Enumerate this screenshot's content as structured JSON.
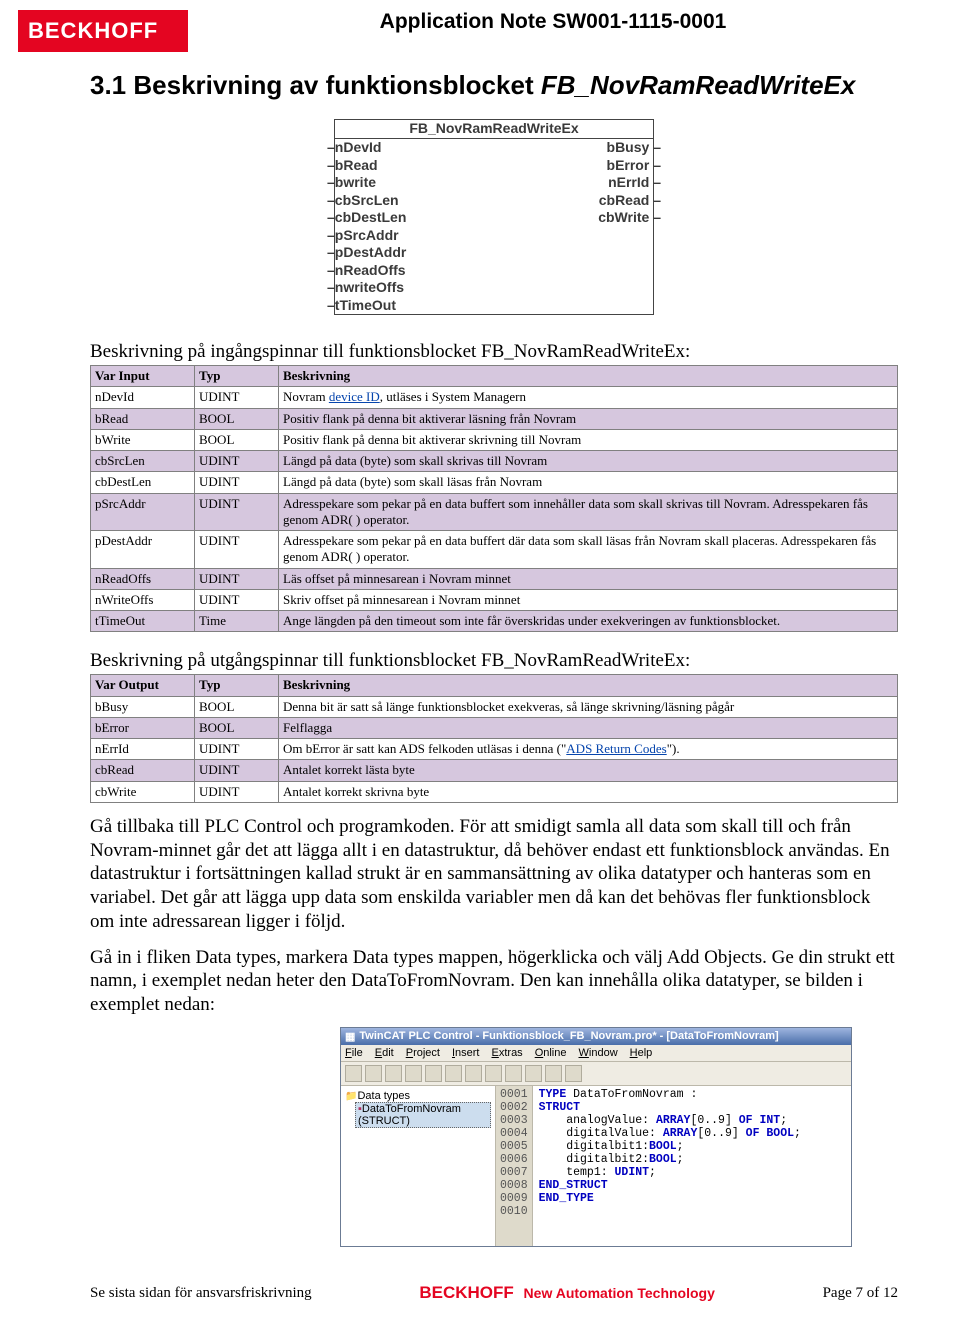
{
  "doc_header": {
    "logo_text": "BECKHOFF",
    "title": "Application Note SW001-1115-0001"
  },
  "section": {
    "number": "3.1",
    "title_lead": "Beskrivning av funktionsblocket",
    "fb_name": "FB_NovRamReadWriteEx"
  },
  "fb_diagram": {
    "title": "FB_NovRamReadWriteEx",
    "rows": [
      {
        "l": "nDevId",
        "r": "bBusy"
      },
      {
        "l": "bRead",
        "r": "bError"
      },
      {
        "l": "bwrite",
        "r": "nErrId"
      },
      {
        "l": "cbSrcLen",
        "r": "cbRead"
      },
      {
        "l": "cbDestLen",
        "r": "cbWrite"
      },
      {
        "l": "pSrcAddr",
        "r": ""
      },
      {
        "l": "pDestAddr",
        "r": ""
      },
      {
        "l": "nReadOffs",
        "r": ""
      },
      {
        "l": "nwriteOffs",
        "r": ""
      },
      {
        "l": "tTimeOut",
        "r": ""
      }
    ]
  },
  "input_caption": "Beskrivning på ingångspinnar till funktionsblocket FB_NovRamReadWriteEx:",
  "input_table": {
    "headers": [
      "Var Input",
      "Typ",
      "Beskrivning"
    ],
    "rows": [
      {
        "c0": "nDevId",
        "c1": "UDINT",
        "c2_pre": "Novram ",
        "c2_link": "device ID",
        "c2_post": ", utläses i System Managern"
      },
      {
        "c0": "bRead",
        "c1": "BOOL",
        "c2": "Positiv flank på denna bit aktiverar läsning från Novram"
      },
      {
        "c0": "bWrite",
        "c1": "BOOL",
        "c2": "Positiv flank på denna bit aktiverar skrivning till Novram"
      },
      {
        "c0": "cbSrcLen",
        "c1": "UDINT",
        "c2": "Längd på data (byte) som skall skrivas till Novram"
      },
      {
        "c0": "cbDestLen",
        "c1": "UDINT",
        "c2": "Längd på data (byte) som skall läsas från Novram"
      },
      {
        "c0": "pSrcAddr",
        "c1": "UDINT",
        "c2": "Adresspekare som pekar på en data buffert som innehåller data som skall skrivas till Novram. Adresspekaren fås genom ADR( ) operator."
      },
      {
        "c0": "pDestAddr",
        "c1": "UDINT",
        "c2": "Adresspekare som pekar på en data buffert där data som skall läsas från Novram skall placeras. Adresspekaren fås genom ADR( ) operator."
      },
      {
        "c0": "nReadOffs",
        "c1": "UDINT",
        "c2": "Läs offset på minnesarean i Novram minnet"
      },
      {
        "c0": "nWriteOffs",
        "c1": "UDINT",
        "c2": "Skriv offset på minnesarean i Novram minnet"
      },
      {
        "c0": "tTimeOut",
        "c1": "Time",
        "c2": "Ange längden på den timeout som inte får överskridas under exekveringen av funktionsblocket."
      }
    ]
  },
  "output_caption": "Beskrivning på utgångspinnar till funktionsblocket FB_NovRamReadWriteEx:",
  "output_table": {
    "headers": [
      "Var Output",
      "Typ",
      "Beskrivning"
    ],
    "rows": [
      {
        "c0": "bBusy",
        "c1": "BOOL",
        "c2": "Denna bit är satt så länge funktionsblocket exekveras, så länge skrivning/läsning pågår"
      },
      {
        "c0": "bError",
        "c1": "BOOL",
        "c2": "Felflagga"
      },
      {
        "c0": "nErrId",
        "c1": "UDINT",
        "c2_pre": "Om bError är satt kan ADS felkoden utläsas i denna (\"",
        "c2_link": "ADS Return Codes",
        "c2_post": "\")."
      },
      {
        "c0": "cbRead",
        "c1": "UDINT",
        "c2": "Antalet korrekt lästa byte"
      },
      {
        "c0": "cbWrite",
        "c1": "UDINT",
        "c2": "Antalet korrekt skrivna byte"
      }
    ]
  },
  "body_paragraphs": {
    "p1": "Gå tillbaka till PLC Control och programkoden. För att smidigt samla all data som skall till och från Novram-minnet går det att lägga allt i en datastruktur, då behöver endast ett funktionsblock användas. En datastruktur i fortsättningen kallad strukt är en sammansättning av olika datatyper och hanteras som en variabel. Det går att lägga upp data som enskilda variabler men då kan det behövas fler funktionsblock om inte adressarean ligger i följd.",
    "p2": "Gå in i fliken Data types, markera Data types mappen, högerklicka och välj Add Objects. Ge din strukt ett namn, i exemplet nedan heter den DataToFromNovram. Den kan innehålla olika datatyper, se bilden i exemplet nedan:"
  },
  "ide": {
    "title": "TwinCAT PLC Control - Funktionsblock_FB_Novram.pro* - [DataToFromNovram]",
    "menu": [
      "File",
      "Edit",
      "Project",
      "Insert",
      "Extras",
      "Online",
      "Window",
      "Help"
    ],
    "tree": {
      "folder": "Data types",
      "item": "DataToFromNovram (STRUCT)"
    },
    "code_lines": [
      {
        "n": "0001",
        "t": "TYPE DataToFromNovram :",
        "kw": "TYPE"
      },
      {
        "n": "0002",
        "t": "STRUCT",
        "kw": "STRUCT"
      },
      {
        "n": "0003",
        "t": "    analogValue: ARRAY[0..9] OF INT;"
      },
      {
        "n": "0004",
        "t": "    digitalValue: ARRAY[0..9] OF BOOL;"
      },
      {
        "n": "0005",
        "t": "    digitalbit1:BOOL;"
      },
      {
        "n": "0006",
        "t": "    digitalbit2:BOOL;"
      },
      {
        "n": "0007",
        "t": "    temp1: UDINT;"
      },
      {
        "n": "0008",
        "t": "END_STRUCT",
        "kw": "END_STRUCT"
      },
      {
        "n": "0009",
        "t": "END_TYPE",
        "kw": "END_TYPE"
      },
      {
        "n": "0010",
        "t": ""
      }
    ]
  },
  "footer": {
    "left": "Se sista sidan för ansvarsfriskrivning",
    "logo": "BECKHOFF",
    "tag": "New Automation Technology",
    "page": "Page 7 of 12"
  }
}
